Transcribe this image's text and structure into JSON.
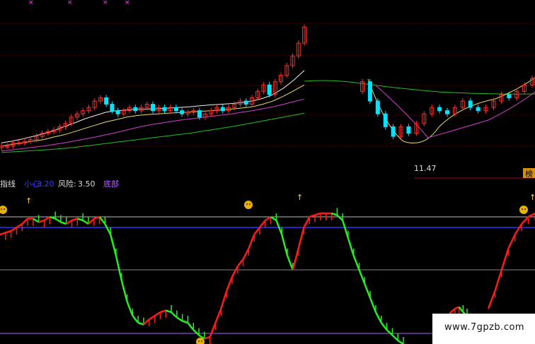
{
  "indicator": {
    "name": "趋势线",
    "name_visible": "指线",
    "careful_label": "小心:",
    "careful_value": "3.20",
    "risk_label": "风险:",
    "risk_value": "3.50",
    "bottom_label": "底部"
  },
  "price_panel": {
    "low_label": "11.47",
    "right_marker": "榜"
  },
  "watermark": "www.7gpzb.com",
  "colors": {
    "up": "#ff2a2a",
    "down": "#00e5ff",
    "ma_white": "#f0f0f0",
    "ma_yellow": "#e8e060",
    "ma_magenta": "#d040d0",
    "ma_green": "#22c022",
    "osc_up": "#ff1a1a",
    "osc_down": "#22ee22",
    "line_risk": "#bbbbbb",
    "line_careful": "#3030ff",
    "line_bottom": "#b060ff",
    "line_mid": "#888888",
    "grid": "#7a0000"
  },
  "chart_data": [
    {
      "type": "candlestick",
      "title": "",
      "segments": [
        {
          "close": [
            10.9,
            10.9,
            11.0,
            11.0,
            11.05,
            11.1,
            11.2,
            11.3,
            11.35,
            11.4,
            11.5,
            11.6,
            11.8,
            11.9,
            12.0,
            12.1,
            12.3,
            12.4,
            12.2,
            12.0,
            11.9,
            12.0,
            12.1,
            12.0,
            12.1,
            12.2,
            12.0,
            12.1,
            12.0,
            12.1,
            12.0,
            11.9,
            11.95,
            12.0,
            11.8,
            11.9,
            12.0,
            12.1,
            12.0,
            12.1,
            12.2,
            12.3,
            12.2,
            12.4,
            12.6,
            12.8,
            12.5,
            12.9,
            13.1,
            13.4,
            13.7,
            14.1,
            14.6
          ],
          "open": [
            10.85,
            10.9,
            10.9,
            11.0,
            11.0,
            11.05,
            11.1,
            11.2,
            11.3,
            11.35,
            11.4,
            11.5,
            11.6,
            11.8,
            11.9,
            12.0,
            12.1,
            12.3,
            12.4,
            12.2,
            12.0,
            11.9,
            12.0,
            12.1,
            12.0,
            12.1,
            12.2,
            12.0,
            12.1,
            12.0,
            12.1,
            12.0,
            11.9,
            11.95,
            12.0,
            11.8,
            11.9,
            12.0,
            12.1,
            12.0,
            12.1,
            12.2,
            12.3,
            12.2,
            12.4,
            12.6,
            12.8,
            12.5,
            12.9,
            13.1,
            13.4,
            13.7,
            14.1
          ]
        },
        {
          "close": [
            12.9,
            12.3,
            11.9,
            11.5,
            11.2,
            11.5,
            11.3,
            11.6,
            11.9,
            12.1,
            12.0,
            11.9,
            12.1,
            12.3,
            12.1,
            12.0,
            12.1,
            12.3,
            12.5,
            12.4,
            12.6,
            12.8,
            13.0
          ],
          "open": [
            12.6,
            12.9,
            12.3,
            11.9,
            11.5,
            11.2,
            11.5,
            11.3,
            11.6,
            11.9,
            12.1,
            12.0,
            11.9,
            12.1,
            12.3,
            12.1,
            12.0,
            12.1,
            12.3,
            12.5,
            12.4,
            12.6,
            12.8
          ]
        }
      ],
      "series": [
        {
          "values": [
            11.0,
            11.05,
            11.12,
            11.2,
            11.28,
            11.38,
            11.5,
            11.62,
            11.75,
            11.85,
            11.95,
            12.0,
            12.02,
            12.05,
            12.05,
            12.06,
            12.08,
            12.1,
            12.12,
            12.15,
            12.18,
            12.2,
            12.22,
            12.25,
            12.3,
            12.38,
            12.5,
            12.7,
            12.95,
            13.25
          ]
        },
        {
          "values": [
            10.9,
            10.95,
            11.0,
            11.05,
            11.1,
            11.18,
            11.25,
            11.35,
            11.45,
            11.55,
            11.65,
            11.72,
            11.8,
            11.85,
            11.88,
            11.9,
            11.92,
            11.94,
            11.96,
            11.98,
            12.0,
            12.02,
            12.05,
            12.08,
            12.12,
            12.2,
            12.3,
            12.45,
            12.62,
            12.8
          ]
        },
        {
          "values": [
            10.75,
            10.78,
            10.82,
            10.86,
            10.9,
            10.95,
            11.0,
            11.06,
            11.12,
            11.18,
            11.25,
            11.32,
            11.4,
            11.48,
            11.55,
            11.6,
            11.65,
            11.7,
            11.74,
            11.78,
            11.82,
            11.86,
            11.9,
            11.95,
            12.0,
            12.06,
            12.12,
            12.2,
            12.28,
            12.36
          ]
        },
        {
          "values": [
            10.7,
            10.72,
            10.74,
            10.76,
            10.78,
            10.8,
            10.83,
            10.86,
            10.9,
            10.94,
            10.98,
            11.02,
            11.06,
            11.1,
            11.14,
            11.18,
            11.22,
            11.26,
            11.3,
            11.35,
            11.4,
            11.45,
            11.5,
            11.56,
            11.62,
            11.68,
            11.74,
            11.8,
            11.86,
            11.92
          ]
        }
      ],
      "low_marker": 11.47
    },
    {
      "type": "line",
      "title": "",
      "reference_lines": [
        {
          "label": "风险",
          "value": 3.5
        },
        {
          "label": "小心",
          "value": 3.2
        },
        {
          "label": "",
          "value": 2.0
        },
        {
          "label": "底部",
          "value": 0.2
        }
      ],
      "segments": [
        {
          "values": [
            3.0,
            3.05,
            3.1,
            3.2,
            3.3,
            3.45,
            3.45,
            3.35,
            3.4,
            3.5,
            3.45,
            3.35,
            3.3,
            3.4,
            3.45,
            3.4,
            3.3,
            3.45,
            3.5,
            3.3,
            3.0,
            2.4,
            1.7,
            1.1,
            0.7,
            0.5,
            0.45,
            0.6,
            0.7,
            0.8,
            0.85,
            0.8,
            0.65,
            0.55,
            0.5,
            0.3,
            0.15,
            0.05,
            0.1,
            0.5,
            0.9,
            1.4,
            1.8,
            2.1,
            2.3,
            2.6,
            3.0,
            3.2,
            3.4,
            3.5,
            3.4,
            3.0,
            2.4,
            2.0,
            2.6,
            3.2,
            3.5,
            3.55,
            3.6,
            3.6,
            3.6,
            3.55,
            3.4,
            2.9,
            2.4,
            2.0,
            1.6,
            1.2,
            0.8,
            0.5,
            0.3,
            0.15,
            0.0,
            -0.1
          ]
        },
        {
          "values": [
            0.3,
            0.4,
            0.6,
            0.8,
            0.9,
            0.95,
            0.8,
            0.7
          ]
        },
        {
          "values": [
            0.9,
            1.4,
            2.0,
            2.6,
            3.0,
            3.3,
            3.5,
            3.6
          ]
        }
      ]
    }
  ]
}
